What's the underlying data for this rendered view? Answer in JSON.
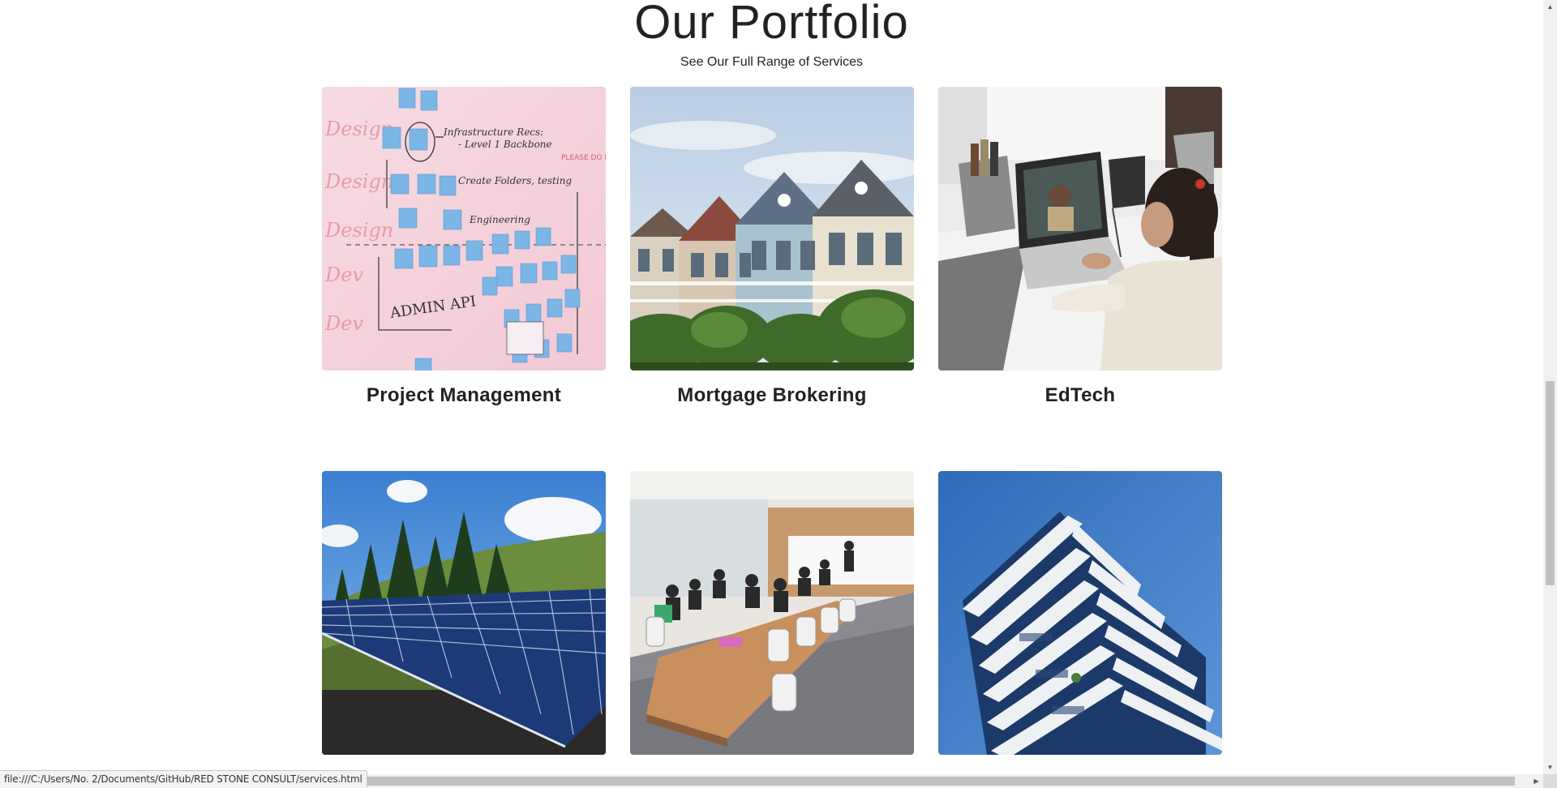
{
  "section": {
    "title": "Our Portfolio",
    "subtitle": "See Our Full Range of Services"
  },
  "cards": [
    {
      "label": "Project Management",
      "image": "whiteboard-sticky-notes"
    },
    {
      "label": "Mortgage Brokering",
      "image": "victorian-houses"
    },
    {
      "label": "EdTech",
      "image": "student-laptop-video-call"
    },
    {
      "label": "",
      "image": "solar-panels"
    },
    {
      "label": "",
      "image": "conference-room-meeting"
    },
    {
      "label": "",
      "image": "modern-apartment-building"
    }
  ],
  "status_bar": {
    "url": "file:///C:/Users/No. 2/Documents/GitHub/RED STONE CONSULT/services.html"
  },
  "colors": {
    "text": "#222222",
    "background": "#ffffff"
  }
}
